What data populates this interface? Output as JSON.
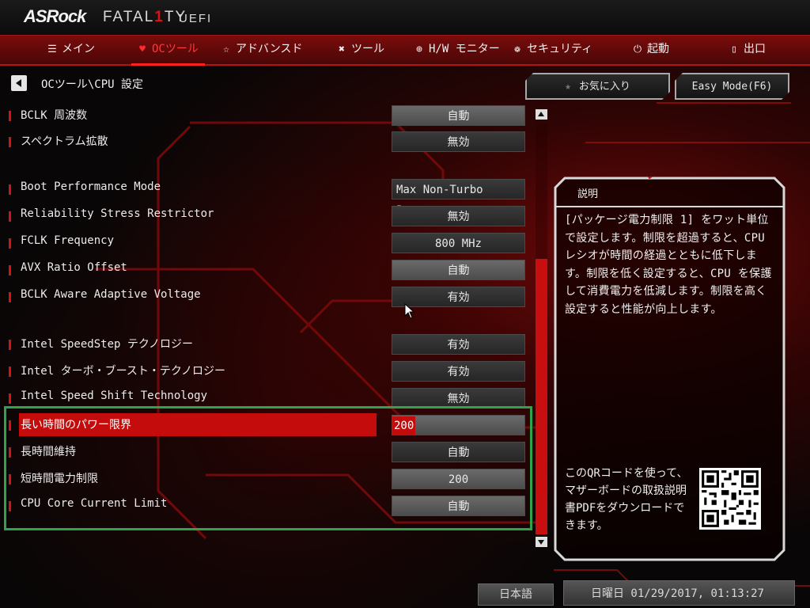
{
  "header": {
    "brand": "ASRock",
    "product": "FATAL",
    "product_one": "1",
    "product_suffix": "TY",
    "uefi": "UEFI"
  },
  "menu": [
    {
      "label": "メイン",
      "icon": "list-icon",
      "active": false
    },
    {
      "label": "OCツール",
      "icon": "flame-icon",
      "active": true
    },
    {
      "label": "アドバンスド",
      "icon": "star-icon",
      "active": false
    },
    {
      "label": "ツール",
      "icon": "tools-icon",
      "active": false
    },
    {
      "label": "H/W モニター",
      "icon": "crosshair-icon",
      "active": false
    },
    {
      "label": "セキュリティ",
      "icon": "shield-icon",
      "active": false
    },
    {
      "label": "起動",
      "icon": "power-icon",
      "active": false
    },
    {
      "label": "出口",
      "icon": "exit-door-icon",
      "active": false
    }
  ],
  "breadcrumb": "OCツール\\CPU 設定",
  "buttons": {
    "favorites": "お気に入り",
    "easy_mode": "Easy Mode(F6)"
  },
  "settings": [
    {
      "label": "BCLK 周波数",
      "value": "自動"
    },
    {
      "label": "スペクトラム拡散",
      "value": "無効"
    },
    {
      "label": "Boot Performance Mode",
      "value": "Max Non-Turbo Per..."
    },
    {
      "label": "Reliability Stress Restrictor",
      "value": "無効"
    },
    {
      "label": "FCLK Frequency",
      "value": "800 MHz"
    },
    {
      "label": "AVX Ratio Offset",
      "value": "自動"
    },
    {
      "label": "BCLK Aware Adaptive Voltage",
      "value": "有効"
    },
    {
      "label": "Intel SpeedStep テクノロジー",
      "value": "有効"
    },
    {
      "label": "Intel ターボ・ブースト・テクノロジー",
      "value": "有効"
    },
    {
      "label": "Intel Speed Shift Technology",
      "value": "無効"
    },
    {
      "label": "長い時間のパワー限界",
      "value": "200",
      "selected": true
    },
    {
      "label": "長時間維持",
      "value": "自動"
    },
    {
      "label": "短時間電力制限",
      "value": "200"
    },
    {
      "label": "CPU Core Current Limit",
      "value": "自動"
    }
  ],
  "description": {
    "title": "説明",
    "text": "[パッケージ電力制限 1] をワット単位で設定します。制限を超過すると、CPU レシオが時間の経過とともに低下します。制限を低く設定すると、CPU を保護して消費電力を低減します。制限を高く設定すると性能が向上します。",
    "qr_text": "このQRコードを使って、マザーボードの取扱説明書PDFをダウンロードできます。"
  },
  "footer": {
    "language": "日本語",
    "datetime": "日曜日 01/29/2017, 01:13:27"
  },
  "colors": {
    "accent": "#c40c0c",
    "highlight_box": "#2fa24a"
  }
}
